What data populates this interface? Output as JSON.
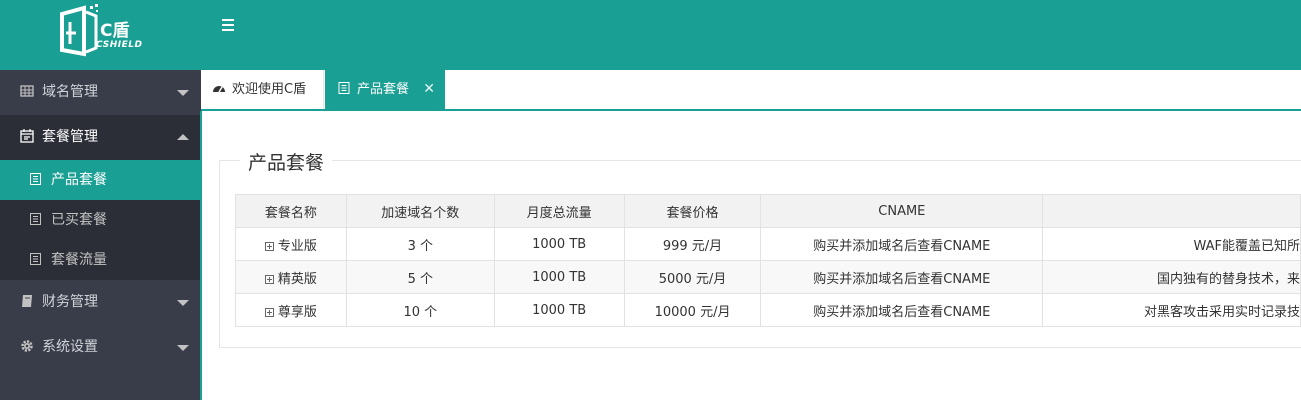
{
  "brand": {
    "name_cn": "C盾",
    "name_en": "CSHIELD"
  },
  "sidebar": {
    "items": [
      {
        "label": "域名管理",
        "icon": "grid-icon",
        "expanded": false
      },
      {
        "label": "套餐管理",
        "icon": "calendar-icon",
        "expanded": true,
        "children": [
          {
            "label": "产品套餐",
            "active": true
          },
          {
            "label": "已买套餐",
            "active": false
          },
          {
            "label": "套餐流量",
            "active": false
          }
        ]
      },
      {
        "label": "财务管理",
        "icon": "book-icon",
        "expanded": false
      },
      {
        "label": "系统设置",
        "icon": "gear-icon",
        "expanded": false
      }
    ]
  },
  "tabs": [
    {
      "label": "欢迎使用C盾",
      "icon": "dashboard-icon",
      "active": false
    },
    {
      "label": "产品套餐",
      "icon": "document-icon",
      "active": true,
      "close": "✕"
    }
  ],
  "panel": {
    "legend": "产品套餐"
  },
  "table": {
    "headers": [
      "套餐名称",
      "加速域名个数",
      "月度总流量",
      "套餐价格",
      "CNAME",
      ""
    ],
    "rows": [
      [
        "专业版",
        "3 个",
        "1000 TB",
        "999 元/月",
        "购买并添加域名后查看CNAME",
        "WAF能覆盖已知所"
      ],
      [
        "精英版",
        "5 个",
        "1000 TB",
        "5000 元/月",
        "购买并添加域名后查看CNAME",
        "国内独有的替身技术，来"
      ],
      [
        "尊享版",
        "10 个",
        "1000 TB",
        "10000 元/月",
        "购买并添加域名后查看CNAME",
        "对黑客攻击采用实时记录技"
      ]
    ]
  },
  "colors": {
    "primary": "#1a9f94",
    "sidebar": "#393d49",
    "sidebar_sub": "#2b2e37"
  }
}
